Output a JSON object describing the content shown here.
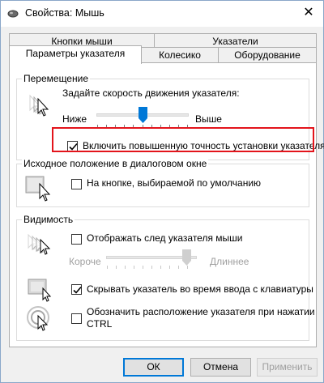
{
  "window": {
    "title": "Свойства: Мышь",
    "close_glyph": "✕"
  },
  "tabs": {
    "row1": [
      {
        "label": "Кнопки мыши"
      },
      {
        "label": "Указатели"
      }
    ],
    "row2": [
      {
        "label": "Параметры указателя",
        "active": true
      },
      {
        "label": "Колесико"
      },
      {
        "label": "Оборудование"
      }
    ]
  },
  "motion": {
    "group_label": "Перемещение",
    "speed_label": "Задайте скорость движения указателя:",
    "slow_label": "Ниже",
    "fast_label": "Выше",
    "speed_value": 6,
    "speed_max": 11,
    "precision_label": "Включить повышенную точность установки указателя",
    "precision_checked": true,
    "icon": "pointer-speed-icon"
  },
  "snap": {
    "group_label": "Исходное положение в диалоговом окне",
    "label": "На кнопке, выбираемой по умолчанию",
    "checked": false,
    "icon": "snap-to-button-icon"
  },
  "visibility": {
    "group_label": "Видимость",
    "trails_label": "Отображать след указателя мыши",
    "trails_checked": false,
    "trails_short": "Короче",
    "trails_long": "Длиннее",
    "trails_value": 10,
    "trails_max": 10,
    "hide_label": "Скрывать указатель во время ввода с клавиатуры",
    "hide_checked": true,
    "locate_label_line1": "Обозначить расположение указателя при нажатии",
    "locate_label_line2": "CTRL",
    "locate_checked": false,
    "icons": [
      "pointer-trails-icon",
      "hide-pointer-icon",
      "locate-pointer-icon"
    ]
  },
  "buttons": {
    "ok": "ОК",
    "cancel": "Отмена",
    "apply": "Применить"
  },
  "colors": {
    "highlight": "#e3141b",
    "accent": "#0078d7"
  }
}
